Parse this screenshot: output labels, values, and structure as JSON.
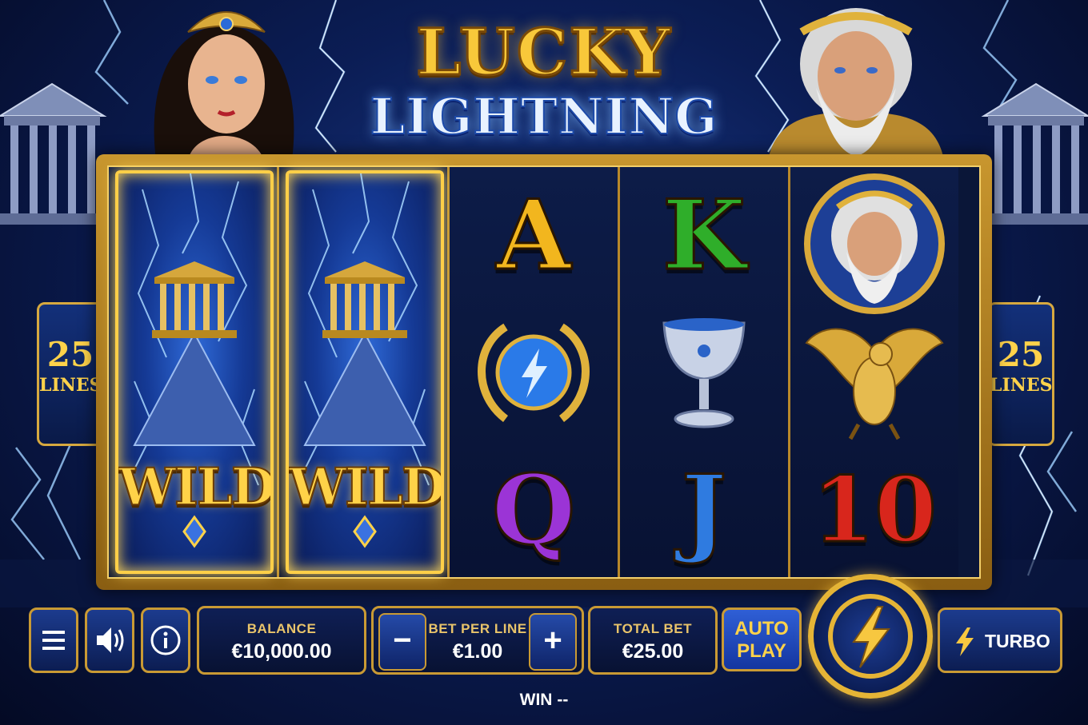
{
  "title": {
    "line1": "LUCKY",
    "line2": "LIGHTNING"
  },
  "lines_left": {
    "count": "25",
    "label": "LINES"
  },
  "lines_right": {
    "count": "25",
    "label": "LINES"
  },
  "reels": {
    "reel1": {
      "symbol": "WILD"
    },
    "reel2": {
      "symbol": "WILD"
    },
    "reel3": {
      "top": "A",
      "middle": "laurel-lightning-icon",
      "bottom": "Q"
    },
    "reel4": {
      "top": "K",
      "middle": "chalice-icon",
      "bottom": "J"
    },
    "reel5": {
      "top": "zeus-portrait-icon",
      "middle": "eagle-icon",
      "bottom": "10"
    }
  },
  "symbol_colors": {
    "A": "#f2b61e",
    "K": "#2fae2a",
    "Q": "#9b34d6",
    "J": "#2f7be0",
    "10": "#d8261c"
  },
  "controls": {
    "menu_icon": "menu-icon",
    "sound_icon": "speaker-icon",
    "info_icon": "info-icon",
    "balance_label": "BALANCE",
    "balance_value": "€10,000.00",
    "bet_label": "BET PER LINE",
    "bet_value": "€1.00",
    "minus": "−",
    "plus": "+",
    "total_label": "TOTAL BET",
    "total_value": "€25.00",
    "auto_line1": "AUTO",
    "auto_line2": "PLAY",
    "turbo_label": "TURBO",
    "win_label": "WIN",
    "win_value": "--"
  }
}
